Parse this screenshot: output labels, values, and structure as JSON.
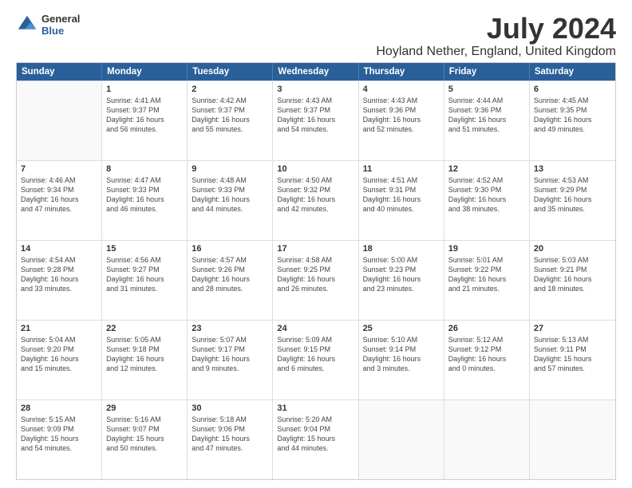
{
  "logo": {
    "line1": "General",
    "line2": "Blue"
  },
  "title": "July 2024",
  "subtitle": "Hoyland Nether, England, United Kingdom",
  "headers": [
    "Sunday",
    "Monday",
    "Tuesday",
    "Wednesday",
    "Thursday",
    "Friday",
    "Saturday"
  ],
  "weeks": [
    [
      {
        "day": "",
        "lines": []
      },
      {
        "day": "1",
        "lines": [
          "Sunrise: 4:41 AM",
          "Sunset: 9:37 PM",
          "Daylight: 16 hours",
          "and 56 minutes."
        ]
      },
      {
        "day": "2",
        "lines": [
          "Sunrise: 4:42 AM",
          "Sunset: 9:37 PM",
          "Daylight: 16 hours",
          "and 55 minutes."
        ]
      },
      {
        "day": "3",
        "lines": [
          "Sunrise: 4:43 AM",
          "Sunset: 9:37 PM",
          "Daylight: 16 hours",
          "and 54 minutes."
        ]
      },
      {
        "day": "4",
        "lines": [
          "Sunrise: 4:43 AM",
          "Sunset: 9:36 PM",
          "Daylight: 16 hours",
          "and 52 minutes."
        ]
      },
      {
        "day": "5",
        "lines": [
          "Sunrise: 4:44 AM",
          "Sunset: 9:36 PM",
          "Daylight: 16 hours",
          "and 51 minutes."
        ]
      },
      {
        "day": "6",
        "lines": [
          "Sunrise: 4:45 AM",
          "Sunset: 9:35 PM",
          "Daylight: 16 hours",
          "and 49 minutes."
        ]
      }
    ],
    [
      {
        "day": "7",
        "lines": [
          "Sunrise: 4:46 AM",
          "Sunset: 9:34 PM",
          "Daylight: 16 hours",
          "and 47 minutes."
        ]
      },
      {
        "day": "8",
        "lines": [
          "Sunrise: 4:47 AM",
          "Sunset: 9:33 PM",
          "Daylight: 16 hours",
          "and 46 minutes."
        ]
      },
      {
        "day": "9",
        "lines": [
          "Sunrise: 4:48 AM",
          "Sunset: 9:33 PM",
          "Daylight: 16 hours",
          "and 44 minutes."
        ]
      },
      {
        "day": "10",
        "lines": [
          "Sunrise: 4:50 AM",
          "Sunset: 9:32 PM",
          "Daylight: 16 hours",
          "and 42 minutes."
        ]
      },
      {
        "day": "11",
        "lines": [
          "Sunrise: 4:51 AM",
          "Sunset: 9:31 PM",
          "Daylight: 16 hours",
          "and 40 minutes."
        ]
      },
      {
        "day": "12",
        "lines": [
          "Sunrise: 4:52 AM",
          "Sunset: 9:30 PM",
          "Daylight: 16 hours",
          "and 38 minutes."
        ]
      },
      {
        "day": "13",
        "lines": [
          "Sunrise: 4:53 AM",
          "Sunset: 9:29 PM",
          "Daylight: 16 hours",
          "and 35 minutes."
        ]
      }
    ],
    [
      {
        "day": "14",
        "lines": [
          "Sunrise: 4:54 AM",
          "Sunset: 9:28 PM",
          "Daylight: 16 hours",
          "and 33 minutes."
        ]
      },
      {
        "day": "15",
        "lines": [
          "Sunrise: 4:56 AM",
          "Sunset: 9:27 PM",
          "Daylight: 16 hours",
          "and 31 minutes."
        ]
      },
      {
        "day": "16",
        "lines": [
          "Sunrise: 4:57 AM",
          "Sunset: 9:26 PM",
          "Daylight: 16 hours",
          "and 28 minutes."
        ]
      },
      {
        "day": "17",
        "lines": [
          "Sunrise: 4:58 AM",
          "Sunset: 9:25 PM",
          "Daylight: 16 hours",
          "and 26 minutes."
        ]
      },
      {
        "day": "18",
        "lines": [
          "Sunrise: 5:00 AM",
          "Sunset: 9:23 PM",
          "Daylight: 16 hours",
          "and 23 minutes."
        ]
      },
      {
        "day": "19",
        "lines": [
          "Sunrise: 5:01 AM",
          "Sunset: 9:22 PM",
          "Daylight: 16 hours",
          "and 21 minutes."
        ]
      },
      {
        "day": "20",
        "lines": [
          "Sunrise: 5:03 AM",
          "Sunset: 9:21 PM",
          "Daylight: 16 hours",
          "and 18 minutes."
        ]
      }
    ],
    [
      {
        "day": "21",
        "lines": [
          "Sunrise: 5:04 AM",
          "Sunset: 9:20 PM",
          "Daylight: 16 hours",
          "and 15 minutes."
        ]
      },
      {
        "day": "22",
        "lines": [
          "Sunrise: 5:05 AM",
          "Sunset: 9:18 PM",
          "Daylight: 16 hours",
          "and 12 minutes."
        ]
      },
      {
        "day": "23",
        "lines": [
          "Sunrise: 5:07 AM",
          "Sunset: 9:17 PM",
          "Daylight: 16 hours",
          "and 9 minutes."
        ]
      },
      {
        "day": "24",
        "lines": [
          "Sunrise: 5:09 AM",
          "Sunset: 9:15 PM",
          "Daylight: 16 hours",
          "and 6 minutes."
        ]
      },
      {
        "day": "25",
        "lines": [
          "Sunrise: 5:10 AM",
          "Sunset: 9:14 PM",
          "Daylight: 16 hours",
          "and 3 minutes."
        ]
      },
      {
        "day": "26",
        "lines": [
          "Sunrise: 5:12 AM",
          "Sunset: 9:12 PM",
          "Daylight: 16 hours",
          "and 0 minutes."
        ]
      },
      {
        "day": "27",
        "lines": [
          "Sunrise: 5:13 AM",
          "Sunset: 9:11 PM",
          "Daylight: 15 hours",
          "and 57 minutes."
        ]
      }
    ],
    [
      {
        "day": "28",
        "lines": [
          "Sunrise: 5:15 AM",
          "Sunset: 9:09 PM",
          "Daylight: 15 hours",
          "and 54 minutes."
        ]
      },
      {
        "day": "29",
        "lines": [
          "Sunrise: 5:16 AM",
          "Sunset: 9:07 PM",
          "Daylight: 15 hours",
          "and 50 minutes."
        ]
      },
      {
        "day": "30",
        "lines": [
          "Sunrise: 5:18 AM",
          "Sunset: 9:06 PM",
          "Daylight: 15 hours",
          "and 47 minutes."
        ]
      },
      {
        "day": "31",
        "lines": [
          "Sunrise: 5:20 AM",
          "Sunset: 9:04 PM",
          "Daylight: 15 hours",
          "and 44 minutes."
        ]
      },
      {
        "day": "",
        "lines": []
      },
      {
        "day": "",
        "lines": []
      },
      {
        "day": "",
        "lines": []
      }
    ]
  ]
}
